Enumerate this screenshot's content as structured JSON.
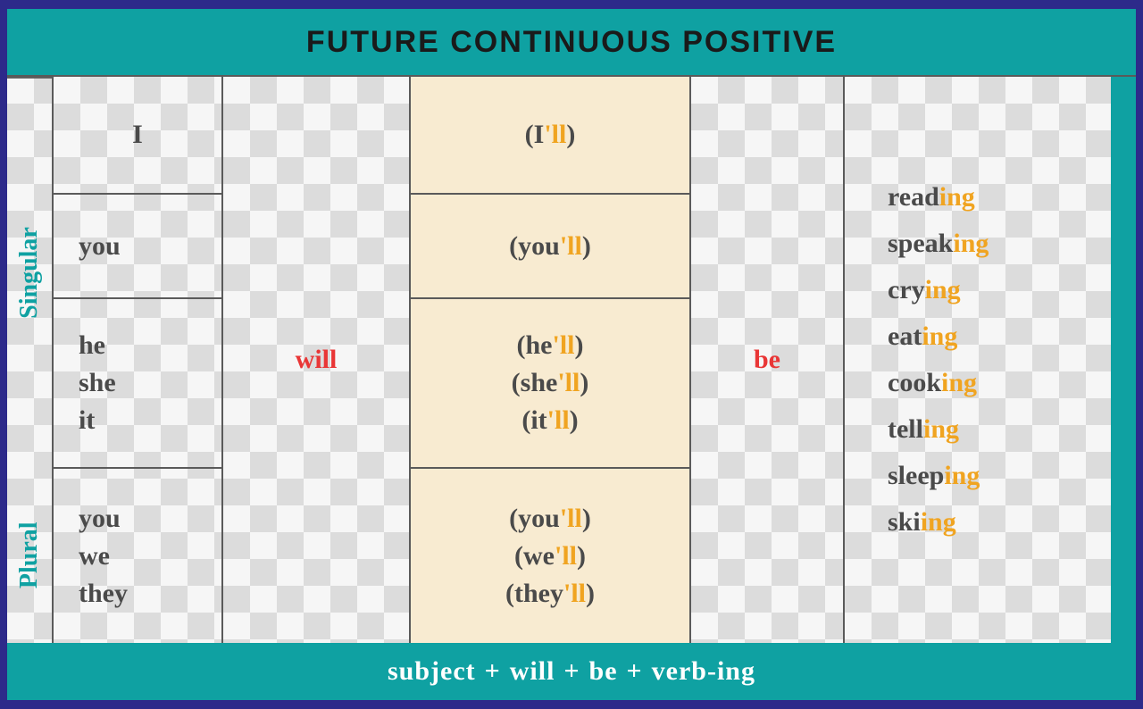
{
  "title": "FUTURE CONTINUOUS POSITIVE",
  "side": {
    "singular": "Singular",
    "plural": "Plural"
  },
  "pronouns": {
    "row1": "I",
    "row2": "you",
    "row3": [
      "he",
      "she",
      "it"
    ],
    "row4": [
      "you",
      "we",
      "they"
    ]
  },
  "aux": {
    "will": "will",
    "be": "be"
  },
  "contractions": {
    "row1": {
      "open": "(I",
      "ll": "'ll",
      "close": ")"
    },
    "row2": {
      "open": "(you",
      "ll": "'ll",
      "close": ")"
    },
    "row3": [
      {
        "open": "(he",
        "ll": "'ll",
        "close": ")"
      },
      {
        "open": "(she",
        "ll": "'ll",
        "close": ")"
      },
      {
        "open": "(it",
        "ll": "'ll",
        "close": ")"
      }
    ],
    "row4": [
      {
        "open": "(you",
        "ll": "'ll",
        "close": ")"
      },
      {
        "open": "(we",
        "ll": "'ll",
        "close": ")"
      },
      {
        "open": "(they",
        "ll": "'ll",
        "close": ")"
      }
    ]
  },
  "verbs": [
    {
      "stem": "read",
      "ing": "ing"
    },
    {
      "stem": "speak",
      "ing": "ing"
    },
    {
      "stem": "cry",
      "ing": "ing"
    },
    {
      "stem": "eat",
      "ing": "ing"
    },
    {
      "stem": "cook",
      "ing": "ing"
    },
    {
      "stem": "tell",
      "ing": "ing"
    },
    {
      "stem": "sleep",
      "ing": "ing"
    },
    {
      "stem": "ski",
      "ing": "ing"
    }
  ],
  "footer": {
    "p1": "subject",
    "plus1": "+",
    "p2": "will",
    "plus2": "+",
    "p3": "be",
    "plus3": "+",
    "p4": "verb-ing"
  }
}
